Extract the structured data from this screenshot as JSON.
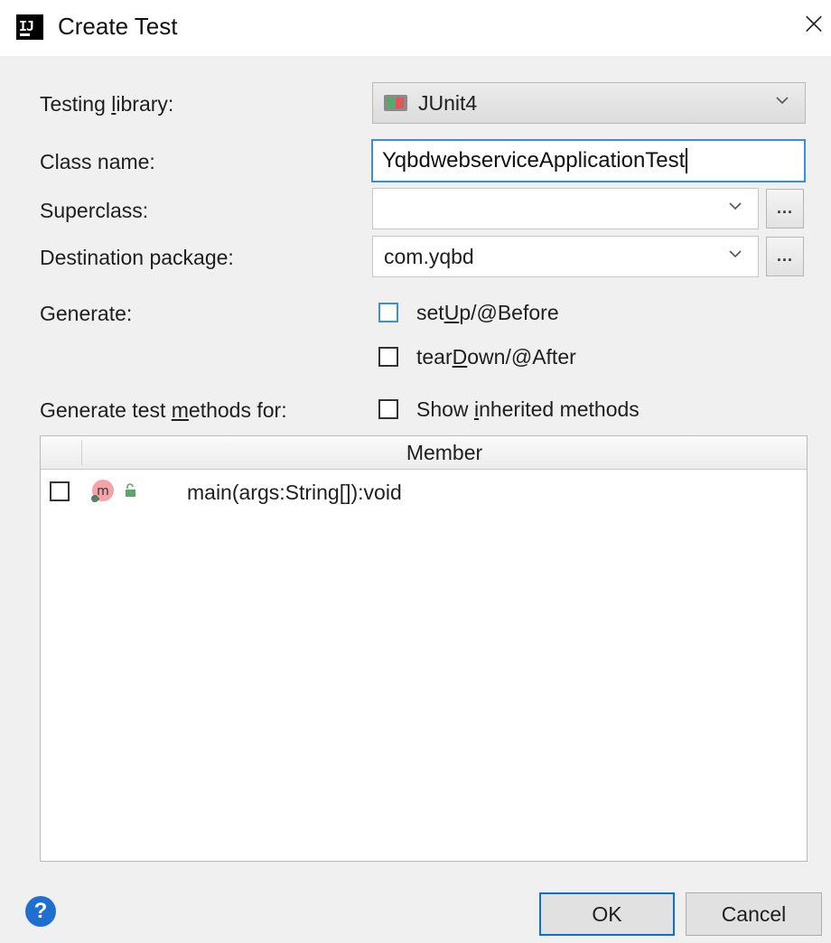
{
  "window": {
    "title": "Create Test",
    "logo_text": "IJ",
    "close_glyph": "×"
  },
  "form": {
    "testing_library": {
      "label_pre": "Testing ",
      "label_mn": "l",
      "label_post": "ibrary:",
      "value": "JUnit4",
      "icon": "junit-icon"
    },
    "class_name": {
      "label": "Class name:",
      "value": "YqbdwebserviceApplicationTest"
    },
    "superclass": {
      "label": "Superclass:",
      "value": "",
      "browse_label": "..."
    },
    "destination_package": {
      "label": "Destination package:",
      "value": "com.yqbd",
      "browse_label": "..."
    },
    "generate": {
      "label": "Generate:",
      "setup": {
        "pre": "set",
        "mn": "U",
        "post": "p/@Before",
        "checked": false
      },
      "teardown": {
        "pre": "tear",
        "mn": "D",
        "post": "own/@After",
        "checked": false
      }
    },
    "generate_methods": {
      "label_pre": "Generate test ",
      "label_mn": "m",
      "label_post": "ethods for:",
      "show_inherited": {
        "pre": "Show ",
        "mn": "i",
        "post": "nherited methods",
        "checked": false
      }
    }
  },
  "table": {
    "column_header": "Member",
    "rows": [
      {
        "checked": false,
        "icon": "method-icon",
        "icon_letter": "m",
        "access_icon": "public-lock-icon",
        "text": "main(args:String[]):void"
      }
    ]
  },
  "footer": {
    "help_glyph": "?",
    "ok_label": "OK",
    "cancel_label": "Cancel"
  },
  "colors": {
    "focus_blue": "#3c8fd6",
    "default_button_border": "#0b6fd6",
    "dialog_bg": "#f0f0f0",
    "method_icon_bg": "#f4a3a8"
  }
}
